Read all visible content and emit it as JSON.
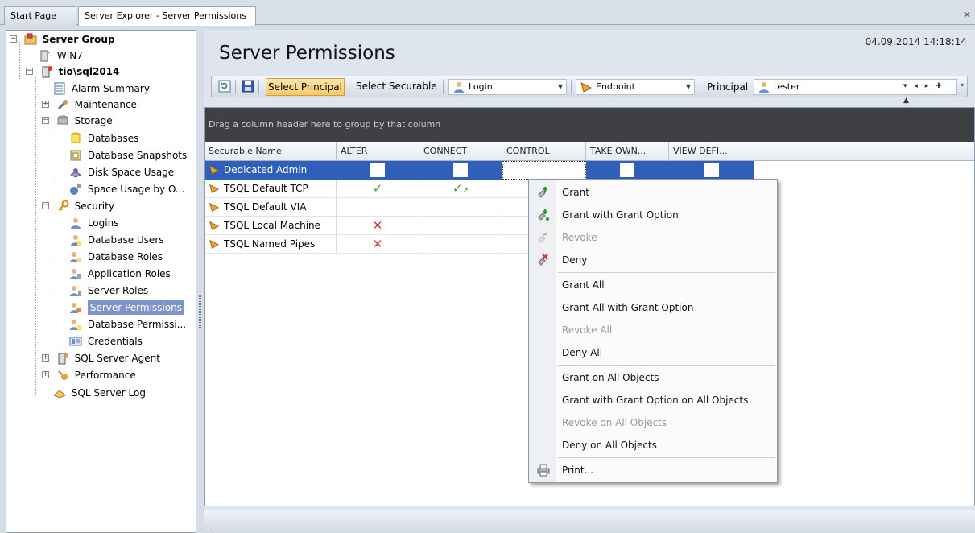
{
  "tabs": [
    {
      "label": "Start Page"
    },
    {
      "label": "Server Explorer - Server Permissions"
    }
  ],
  "tree": {
    "server_group": "Server Group",
    "win7": "WIN7",
    "server": "tio\\sql2014",
    "alarm_summary": "Alarm Summary",
    "maintenance": "Maintenance",
    "storage": "Storage",
    "databases": "Databases",
    "database_snapshots": "Database Snapshots",
    "disk_space_usage": "Disk Space Usage",
    "space_usage_by": "Space Usage by O...",
    "security": "Security",
    "logins": "Logins",
    "database_users": "Database Users",
    "database_roles": "Database Roles",
    "application_roles": "Application Roles",
    "server_roles": "Server Roles",
    "server_permissions": "Server Permissions",
    "database_permissions": "Database Permissi...",
    "credentials": "Credentials",
    "sql_server_agent": "SQL Server Agent",
    "performance": "Performance",
    "sql_server_log": "SQL Server Log"
  },
  "header": {
    "title": "Server Permissions",
    "datetime": "04.09.2014 14:18:14"
  },
  "toolbar": {
    "select_principal": "Select Principal",
    "select_securable": "Select Securable",
    "type_combo": "Login",
    "securable_combo": "Endpoint",
    "principal_label": "Principal",
    "principal_value": "tester"
  },
  "grid": {
    "group_hint": "Drag a column header here to group by that column",
    "columns": [
      "Securable Name",
      "ALTER",
      "CONNECT",
      "CONTROL",
      "TAKE OWN...",
      "VIEW DEFI..."
    ],
    "rows": [
      {
        "name": "Dedicated Admin Conne",
        "alter": "",
        "connect": "",
        "control": "",
        "take_own": "",
        "view_def": ""
      },
      {
        "name": "TSQL Default TCP",
        "alter": "grant",
        "connect": "grant_with_option",
        "control": "",
        "take_own": "",
        "view_def": ""
      },
      {
        "name": "TSQL Default VIA",
        "alter": "",
        "connect": "",
        "control": "",
        "take_own": "",
        "view_def": ""
      },
      {
        "name": "TSQL Local Machine",
        "alter": "deny",
        "connect": "",
        "control": "",
        "take_own": "",
        "view_def": ""
      },
      {
        "name": "TSQL Named Pipes",
        "alter": "deny",
        "connect": "",
        "control": "",
        "take_own": "",
        "view_def": ""
      }
    ]
  },
  "context_menu": {
    "grant": "Grant",
    "grant_with_option": "Grant with Grant Option",
    "revoke": "Revoke",
    "deny": "Deny",
    "grant_all": "Grant All",
    "grant_all_with_option": "Grant All with Grant Option",
    "revoke_all": "Revoke All",
    "deny_all": "Deny All",
    "grant_on_all": "Grant on All Objects",
    "grant_with_option_on_all": "Grant with Grant Option on All Objects",
    "revoke_on_all": "Revoke on All Objects",
    "deny_on_all": "Deny on All Objects",
    "print": "Print..."
  },
  "colors": {
    "selection": "#2f5fb9",
    "tree_selection": "#7d95ca",
    "grant_green": "#4a9a3f",
    "deny_red": "#d23a3a",
    "highlight_button": "#f8c96a"
  }
}
